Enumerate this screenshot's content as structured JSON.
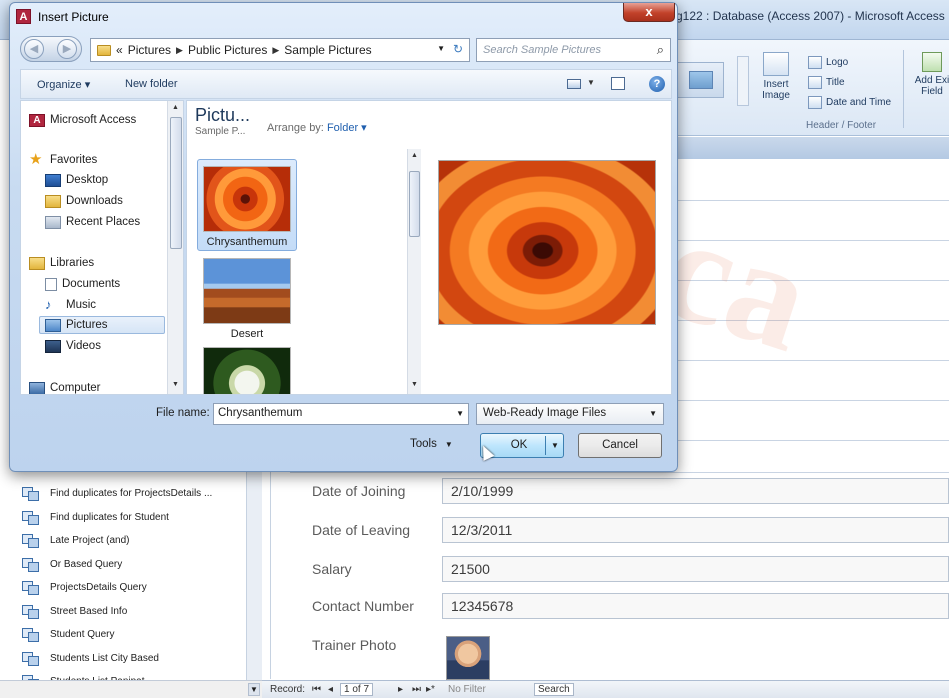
{
  "access": {
    "title": "g122 : Database (Access 2007) - Microsoft Access",
    "ribbon": {
      "insert_image": "Insert Image",
      "logo": "Logo",
      "title": "Title",
      "date_time": "Date and Time",
      "group_label": "Header / Footer",
      "add_existing": "Add Exi Field"
    },
    "form": {
      "fields": [
        {
          "label": "Date of Joining",
          "value": "2/10/1999"
        },
        {
          "label": "Date of Leaving",
          "value": "12/3/2011"
        },
        {
          "label": "Salary",
          "value": "21500"
        },
        {
          "label": "Contact Number",
          "value": "12345678"
        },
        {
          "label": "Trainer Photo",
          "value": ""
        }
      ]
    },
    "nav_items": [
      "Find duplicates for ProjectsDetails ...",
      "Find duplicates for Student",
      "Late Project (and)",
      "Or Based Query",
      "ProjectsDetails Query",
      "Street Based Info",
      "Student Query",
      "Students List City Based",
      "Students List Panipat"
    ],
    "record_bar": {
      "record_label": "Record:",
      "position": "1 of 7",
      "filter": "No Filter",
      "search": "Search"
    }
  },
  "dialog": {
    "title": "Insert Picture",
    "app_icon": "A",
    "close": "x",
    "breadcrumb": [
      "Pictures",
      "Public Pictures",
      "Sample Pictures"
    ],
    "breadcrumb_prefix": "«",
    "search_placeholder": "Search Sample Pictures",
    "toolbar": {
      "organize": "Organize ▾",
      "new_folder": "New folder"
    },
    "left_pane": {
      "microsoft_access": "Microsoft Access",
      "favorites": "Favorites",
      "desktop": "Desktop",
      "downloads": "Downloads",
      "recent_places": "Recent Places",
      "libraries": "Libraries",
      "documents": "Documents",
      "music": "Music",
      "pictures": "Pictures",
      "videos": "Videos",
      "computer": "Computer"
    },
    "library": {
      "title": "Pictu...",
      "subtitle": "Sample P...",
      "arrange_label": "Arrange by:",
      "arrange_value": "Folder ▾"
    },
    "files": [
      {
        "name": "Chrysanthemum",
        "selected": true
      },
      {
        "name": "Desert",
        "selected": false
      },
      {
        "name": "",
        "selected": false
      }
    ],
    "file_name_label": "File name:",
    "file_name_value": "Chrysanthemum",
    "file_type": "Web-Ready Image Files",
    "tools_label": "Tools",
    "ok_label": "OK",
    "cancel_label": "Cancel"
  }
}
